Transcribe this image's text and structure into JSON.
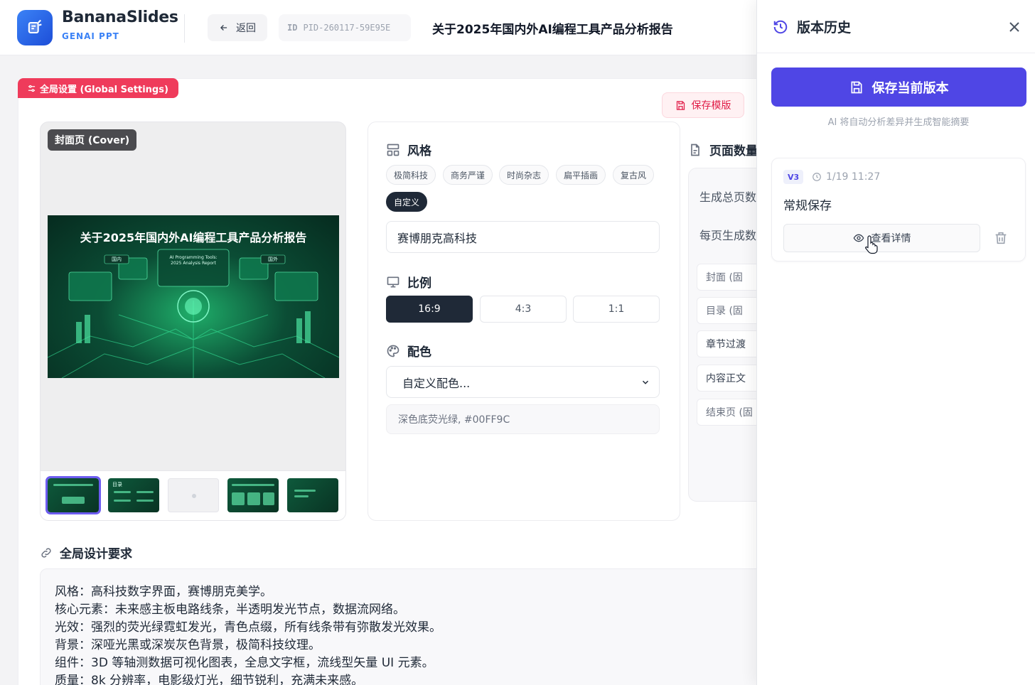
{
  "brand": {
    "name": "BananaSlides",
    "subtitle": "GENAI PPT"
  },
  "header": {
    "back_label": "返回",
    "id_label": "ID",
    "project_id": "PID-260117-59E95E",
    "title": "关于2025年国内外AI编程工具产品分析报告"
  },
  "global_settings": {
    "badge": "全局设置 (Global Settings)",
    "save_template": "保存模版"
  },
  "preview": {
    "cover_tag": "封面页 (Cover)",
    "slide_title": "关于2025年国内外AI编程工具产品分析报告",
    "slide_tag_left": "国内",
    "slide_tag_right": "国外",
    "slide_center_line1": "AI Programming Tools:",
    "slide_center_line2": "2025 Analysis Report",
    "thumbnails": [
      {
        "label": "slide-1",
        "active": true
      },
      {
        "label": "slide-2",
        "active": false,
        "text": "目录"
      },
      {
        "label": "slide-3",
        "active": false,
        "blank": true
      },
      {
        "label": "slide-4",
        "active": false
      },
      {
        "label": "slide-5",
        "active": false
      }
    ]
  },
  "style": {
    "title": "风格",
    "chips": [
      "极简科技",
      "商务严谨",
      "时尚杂志",
      "扁平插画",
      "复古风",
      "自定义"
    ],
    "active_chip": "自定义",
    "custom_value": "赛博朋克高科技"
  },
  "ratio": {
    "title": "比例",
    "options": [
      "16:9",
      "4:3",
      "1:1"
    ],
    "selected": "16:9"
  },
  "color": {
    "title": "配色",
    "selected": "自定义配色...",
    "description": "深色底荧光绿, #00FF9C"
  },
  "pages": {
    "title": "页面数量",
    "total_label": "生成总页数",
    "per_page_label": "每页生成数",
    "items": [
      "封面 (固",
      "目录 (固",
      "章节过渡",
      "内容正文",
      "结束页 (固"
    ]
  },
  "design": {
    "title": "全局设计要求",
    "lines": [
      "风格：高科技数字界面，赛博朋克美学。",
      "核心元素：未来感主板电路线条，半透明发光节点，数据流网络。",
      "光效：强烈的荧光绿霓虹发光，青色点缀，所有线条带有弥散发光效果。",
      "背景：深哑光黑或深炭灰色背景，极简科技纹理。",
      "组件：3D 等轴测数据可视化图表，全息文字框，流线型矢量 UI 元素。",
      "质量：8k 分辨率，电影级灯光，细节锐利，充满未来感。"
    ]
  },
  "history": {
    "title": "版本历史",
    "save_button": "保存当前版本",
    "hint": "AI 将自动分析差异并生成智能摘要",
    "versions": [
      {
        "badge": "V3",
        "time": "1/19 11:27",
        "label": "常规保存",
        "view_label": "查看详情"
      }
    ]
  },
  "colors": {
    "accent": "#4f46e5",
    "danger": "#ef3b5b",
    "brand": "#3b82f6",
    "slide_green": "#00FF9C"
  }
}
